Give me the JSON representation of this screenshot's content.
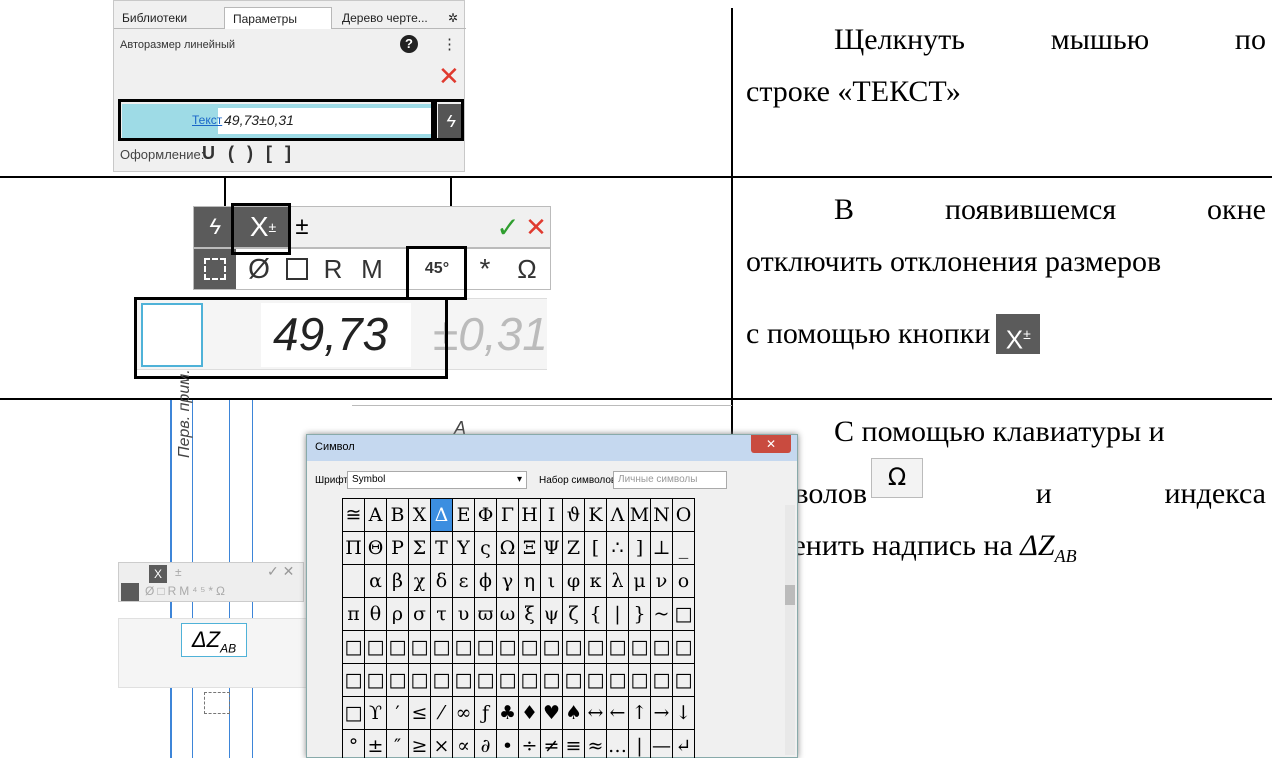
{
  "instructions": {
    "row1": {
      "w1": "Щелкнуть",
      "w2": "мышью",
      "w3": "по",
      "line2": "строке «ТЕКСТ»"
    },
    "row2": {
      "w1": "В",
      "w2": "появившемся",
      "w3": "окне",
      "line2": "отключить отклонения размеров",
      "line3": "с помощью кнопки"
    },
    "row3": {
      "line1": "С помощью клавиатуры и",
      "w1": "символов",
      "w2": "и",
      "w3": "индекса",
      "line3_prefix": "изменить надпись на ",
      "formula": "ΔZ",
      "formula_sub": "AB"
    }
  },
  "panel_params": {
    "tabs": [
      "Библиотеки",
      "Параметры",
      "Дерево черте..."
    ],
    "title": "Авторазмер линейный",
    "text_link": "Текст",
    "text_value": "49,73±0,31",
    "design_label": "Оформление:",
    "design_icons": "U ( ) [ ]"
  },
  "panel_edit": {
    "toolbar": {
      "x_btn": "X",
      "plusminus": "±",
      "r": "R",
      "m": "M",
      "deg": "45°",
      "star": "*",
      "omega": "Ω",
      "dia": "Ø"
    },
    "value": "49,73",
    "tolerance": "±0,31"
  },
  "panel_symbol": {
    "title": "Символ",
    "font_label": "Шрифт",
    "font_value": "Symbol",
    "set_label": "Набор символов",
    "set_value": "Личные символы",
    "drawing_text": "Перв. прим.",
    "drawing_a": "A",
    "small_value": "ΔZ",
    "small_sub": "AB",
    "rows": [
      [
        "≅",
        "A",
        "B",
        "X",
        "Δ",
        "E",
        "Φ",
        "Γ",
        "H",
        "I",
        "ϑ",
        "K",
        "Λ",
        "M",
        "N",
        "O"
      ],
      [
        "Π",
        "Θ",
        "P",
        "Σ",
        "T",
        "Y",
        "ς",
        "Ω",
        "Ξ",
        "Ψ",
        "Z",
        "[",
        "∴",
        "]",
        "⊥",
        "_"
      ],
      [
        "",
        "α",
        "β",
        "χ",
        "δ",
        "ε",
        "ϕ",
        "γ",
        "η",
        "ι",
        "φ",
        "κ",
        "λ",
        "μ",
        "ν",
        "ο"
      ],
      [
        "π",
        "θ",
        "ρ",
        "σ",
        "τ",
        "υ",
        "ϖ",
        "ω",
        "ξ",
        "ψ",
        "ζ",
        "{",
        "|",
        "}",
        "~",
        "□"
      ],
      [
        "□",
        "□",
        "□",
        "□",
        "□",
        "□",
        "□",
        "□",
        "□",
        "□",
        "□",
        "□",
        "□",
        "□",
        "□",
        "□"
      ],
      [
        "□",
        "□",
        "□",
        "□",
        "□",
        "□",
        "□",
        "□",
        "□",
        "□",
        "□",
        "□",
        "□",
        "□",
        "□",
        "□"
      ],
      [
        "□",
        "ϒ",
        "′",
        "≤",
        "⁄",
        "∞",
        "ƒ",
        "♣",
        "♦",
        "♥",
        "♠",
        "↔",
        "←",
        "↑",
        "→",
        "↓"
      ],
      [
        "°",
        "±",
        "″",
        "≥",
        "×",
        "∝",
        "∂",
        "•",
        "÷",
        "≠",
        "≡",
        "≈",
        "…",
        "|",
        "—",
        "↵"
      ]
    ]
  },
  "colors": {
    "accent": "#3c8ee0",
    "text_field": "#9edbe6",
    "dark_toolbar": "#5b5b5b",
    "check": "#2f9e2f",
    "close": "#e03a2f"
  }
}
